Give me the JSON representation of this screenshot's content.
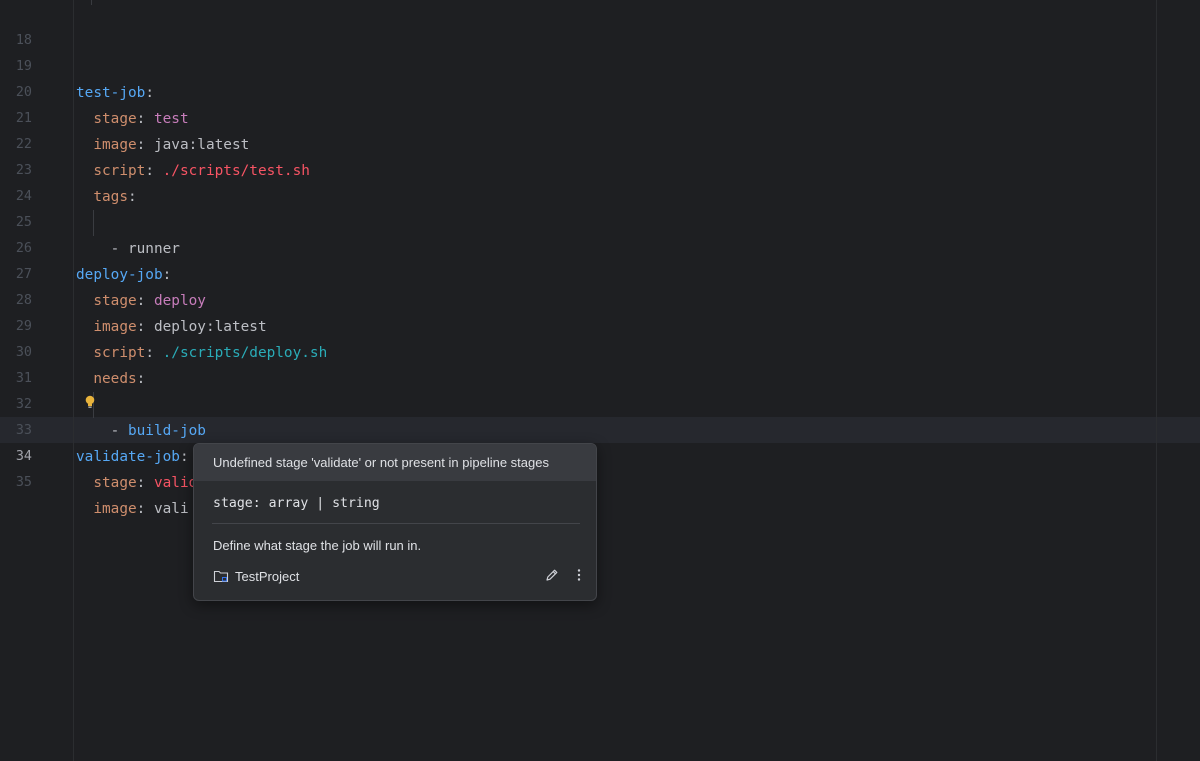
{
  "editor": {
    "line_numbers": [
      "18",
      "19",
      "20",
      "21",
      "22",
      "23",
      "24",
      "25",
      "26",
      "27",
      "28",
      "29",
      "30",
      "31",
      "32",
      "33",
      "34",
      "35"
    ],
    "active_line": "34",
    "lines": {
      "l19": {
        "key": "test-job",
        "colon": ":"
      },
      "l20": {
        "indent": "  ",
        "key": "stage",
        "sep": ": ",
        "value": "test"
      },
      "l21": {
        "indent": "  ",
        "key": "image",
        "sep": ": ",
        "value": "java:latest"
      },
      "l22": {
        "indent": "  ",
        "key": "script",
        "sep": ": ",
        "value": "./scripts/test.sh"
      },
      "l23": {
        "indent": "  ",
        "key": "tags",
        "colon": ":"
      },
      "l24": {
        "indent": "    ",
        "dash": "- ",
        "value": "runner"
      },
      "l26": {
        "key": "deploy-job",
        "colon": ":"
      },
      "l27": {
        "indent": "  ",
        "key": "stage",
        "sep": ": ",
        "value": "deploy"
      },
      "l28": {
        "indent": "  ",
        "key": "image",
        "sep": ": ",
        "value": "deploy:latest"
      },
      "l29": {
        "indent": "  ",
        "key": "script",
        "sep": ": ",
        "value": "./scripts/deploy.sh"
      },
      "l30": {
        "indent": "  ",
        "key": "needs",
        "colon": ":"
      },
      "l31": {
        "indent": "    ",
        "dash": "- ",
        "value": "build-job"
      },
      "l33": {
        "key": "validate-job",
        "colon": ":"
      },
      "l34": {
        "indent": "  ",
        "key": "stage",
        "sep": ": ",
        "value": "validate"
      },
      "l35": {
        "indent": "  ",
        "key": "image",
        "sep": ": ",
        "value": "vali"
      }
    },
    "colors": {
      "key_top": "#56a8f5",
      "key_nested": "#cf8e6d",
      "stage_value": "#c77dbb",
      "error_value": "#f75464",
      "path_value": "#2aacb8"
    }
  },
  "popup": {
    "header": "Undefined stage 'validate' or not present in pipeline stages",
    "signature": "stage: array | string",
    "description": "Define what stage the job will run in.",
    "project": "TestProject",
    "icons": [
      "folder-module-icon",
      "edit-icon",
      "more-options-icon"
    ]
  },
  "intention_icon": "lightbulb-icon"
}
